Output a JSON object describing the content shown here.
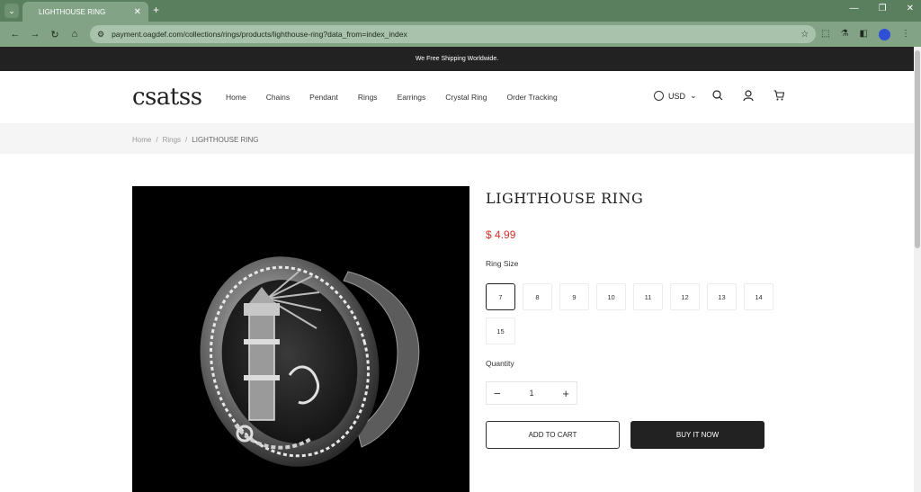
{
  "browser": {
    "tab_title": "LIGHTHOUSE RING",
    "url": "payment.oagdef.com/collections/rings/products/lighthouse-ring?data_from=index_index"
  },
  "store": {
    "announcement": "We Free Shipping Worldwide.",
    "logo": "csatss",
    "nav": [
      "Home",
      "Chains",
      "Pendant",
      "Rings",
      "Earrings",
      "Crystal Ring",
      "Order Tracking"
    ],
    "currency": "USD"
  },
  "breadcrumb": {
    "home": "Home",
    "category": "Rings",
    "current": "LIGHTHOUSE RING"
  },
  "product": {
    "title": "LIGHTHOUSE RING",
    "price": "$ 4.99",
    "size_label": "Ring Size",
    "sizes": [
      "7",
      "8",
      "9",
      "10",
      "11",
      "12",
      "13",
      "14",
      "15"
    ],
    "selected_size": "7",
    "quantity_label": "Quantity",
    "quantity": "1",
    "add_to_cart": "ADD TO CART",
    "buy_now": "BUY IT NOW"
  }
}
